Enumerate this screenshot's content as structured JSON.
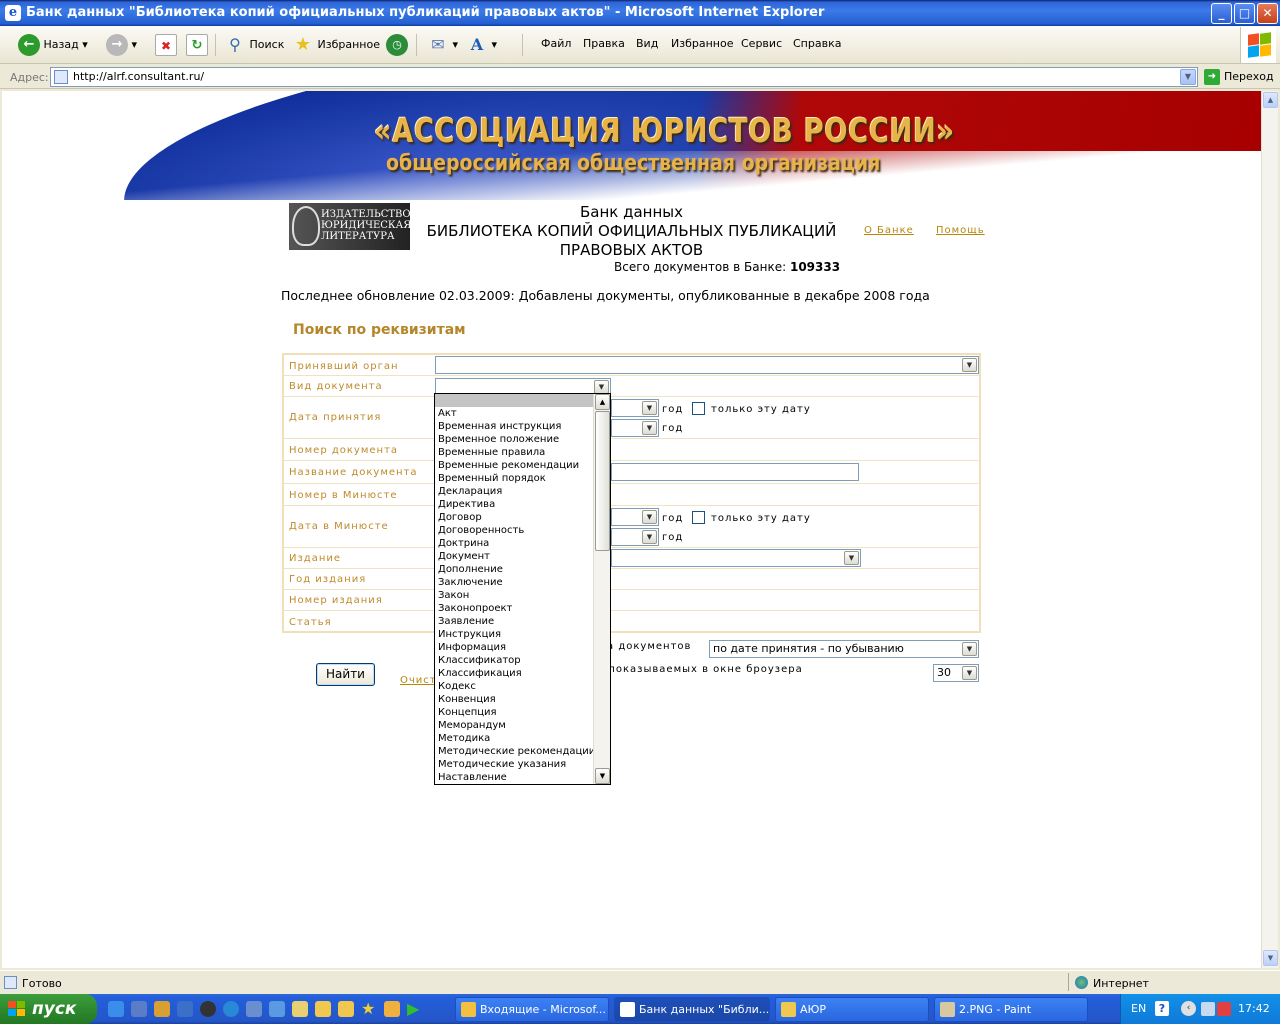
{
  "window": {
    "title": "Банк данных \"Библиотека копий официальных публикаций правовых актов\" - Microsoft Internet Explorer"
  },
  "toolbar": {
    "back_label": "Назад",
    "search_label": "Поиск",
    "favorites_label": "Избранное",
    "menu": [
      "Файл",
      "Правка",
      "Вид",
      "Избранное",
      "Сервис",
      "Справка"
    ]
  },
  "address": {
    "label": "Адрес:",
    "url": "http://alrf.consultant.ru/",
    "go_label": "Переход"
  },
  "banner": {
    "line1": "«АССОЦИАЦИЯ ЮРИСТОВ РОССИИ»",
    "line2": "общероссийская общественная организация"
  },
  "publisher_logo": "ИЗДАТЕЛЬСТВО ЮРИДИЧЕСКАЯ ЛИТЕРАТУРА",
  "header": {
    "line1": "Банк данных",
    "line2": "БИБЛИОТЕКА КОПИЙ ОФИЦИАЛЬНЫХ ПУБЛИКАЦИЙ",
    "line3": "ПРАВОВЫХ АКТОВ",
    "total_label": "Всего документов в Банке:",
    "total_value": "109333",
    "about_link": "О Банке",
    "help_link": "Помощь"
  },
  "update_note": "Последнее обновление 02.03.2009: Добавлены документы, опубликованные в декабре 2008 года",
  "form": {
    "title": "Поиск по реквизитам",
    "labels": {
      "organ": "Принявший орган",
      "doctype": "Вид документа",
      "date": "Дата принятия",
      "number": "Номер документа",
      "name": "Название документа",
      "minjust_number": "Номер в Минюсте",
      "minjust_date": "Дата в Минюсте",
      "edition": "Издание",
      "edition_year": "Год издания",
      "edition_number": "Номер издания",
      "article": "Статья"
    },
    "year_label": "год",
    "only_date_label": "только эту дату",
    "sort_label_fragment": "ка документов",
    "sort_value": "по дате принятия - по убыванию",
    "perpage_label_fragment": ", показываемых в окне броузера",
    "perpage_value": "30",
    "find_button": "Найти",
    "clear_link_fragment": "Очист"
  },
  "doctype_options": [
    "",
    "Акт",
    "Временная инструкция",
    "Временное положение",
    "Временные правила",
    "Временные рекомендации",
    "Временный порядок",
    "Декларация",
    "Директива",
    "Договор",
    "Договоренность",
    "Доктрина",
    "Документ",
    "Дополнение",
    "Заключение",
    "Закон",
    "Законопроект",
    "Заявление",
    "Инструкция",
    "Информация",
    "Классификатор",
    "Классификация",
    "Кодекс",
    "Конвенция",
    "Концепция",
    "Меморандум",
    "Методика",
    "Методические рекомендации",
    "Методические указания",
    "Наставление"
  ],
  "status": {
    "left": "Готово",
    "zone": "Интернет"
  },
  "taskbar": {
    "start": "пуск",
    "tasks": [
      "Входящие - Microsof...",
      "Банк данных \"Библи...",
      "АЮР",
      "2.PNG - Paint"
    ],
    "lang": "EN",
    "time": "17:42"
  }
}
